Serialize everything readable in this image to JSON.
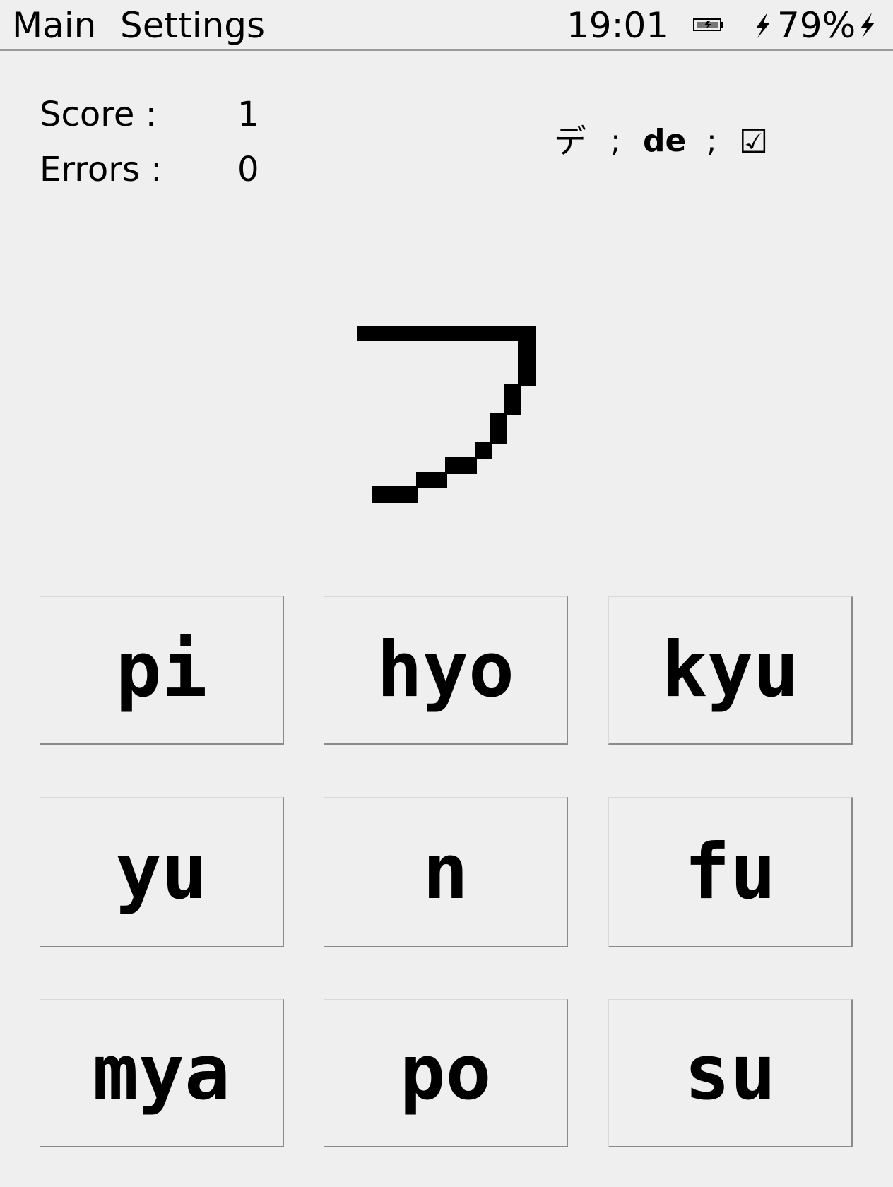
{
  "topbar": {
    "menu": [
      "Main",
      "Settings"
    ],
    "clock": "19:01",
    "battery_percent": "79%",
    "battery_icon": "battery-charging-icon",
    "charging_icon": "lightning-bolt-icon"
  },
  "stats": {
    "score_label": "Score :",
    "score_value": "1",
    "errors_label": "Errors :",
    "errors_value": "0"
  },
  "last_answer": {
    "kana": "デ",
    "separator": ";",
    "romaji": "de",
    "result": "☑"
  },
  "quiz": {
    "character": "フ"
  },
  "answers": [
    "pi",
    "hyo",
    "kyu",
    "yu",
    "n",
    "fu",
    "mya",
    "po",
    "su"
  ]
}
